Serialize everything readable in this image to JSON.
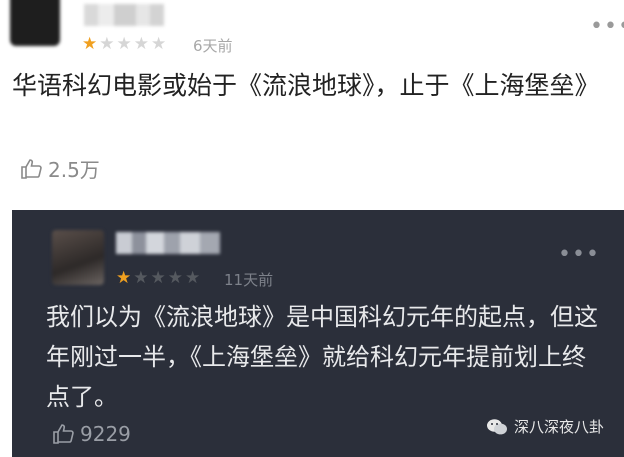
{
  "comment1": {
    "username": "",
    "stars": {
      "filled": 1,
      "total": 5
    },
    "time": "6天前",
    "text": "华语科幻电影或始于《流浪地球》，止于《上海堡垒》",
    "likes": "2.5万"
  },
  "comment2": {
    "username": "",
    "stars": {
      "filled": 1,
      "total": 5
    },
    "time": "11天前",
    "text": "我们以为《流浪地球》是中国科幻元年的起点，但这年刚过一半，《上海堡垒》就给科幻元年提前划上终点了。",
    "likes": "9229"
  },
  "watermark": {
    "text": "深八深夜八卦"
  },
  "colors": {
    "star": "#f0a020",
    "dark_bg": "#2b2f3a"
  }
}
